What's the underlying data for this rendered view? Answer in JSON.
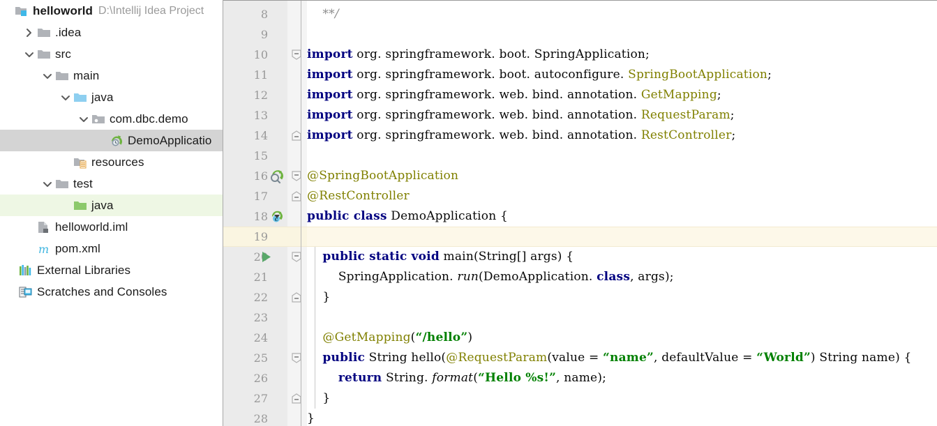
{
  "window": {
    "app": "IntelliJ IDEA",
    "theme_accent": "#3592c4"
  },
  "sidebar": {
    "panel_name": "Project",
    "background": "#ffffff",
    "selected_row_color": "#d4d4d4",
    "test_source_row_color": "#eef7e4",
    "project": {
      "name": "helloworld",
      "path": "D:\\Intellij Idea Project",
      "icon": "project-module-folder-icon"
    },
    "items": [
      {
        "label": ".idea",
        "icon": "folder-icon",
        "indent": 1,
        "twisty": "collapsed",
        "selected": false
      },
      {
        "label": "src",
        "icon": "folder-icon",
        "indent": 1,
        "twisty": "expanded",
        "selected": false
      },
      {
        "label": "main",
        "icon": "folder-icon",
        "indent": 2,
        "twisty": "expanded",
        "selected": false
      },
      {
        "label": "java",
        "icon": "source-root-folder-icon",
        "indent": 3,
        "twisty": "expanded",
        "selected": false
      },
      {
        "label": "com.dbc.demo",
        "icon": "package-folder-icon",
        "indent": 4,
        "twisty": "expanded",
        "selected": false
      },
      {
        "label": "DemoApplicatio",
        "icon": "spring-boot-class-icon",
        "indent": 5,
        "twisty": "none",
        "selected": "gray"
      },
      {
        "label": "resources",
        "icon": "resources-folder-icon",
        "indent": 3,
        "twisty": "none",
        "selected": false
      },
      {
        "label": "test",
        "icon": "folder-icon",
        "indent": 2,
        "twisty": "expanded",
        "selected": false
      },
      {
        "label": "java",
        "icon": "test-source-folder-icon",
        "indent": 3,
        "twisty": "none",
        "selected": "green"
      },
      {
        "label": "helloworld.iml",
        "icon": "iml-module-file-icon",
        "indent": 1,
        "twisty": "none",
        "selected": false
      },
      {
        "label": "pom.xml",
        "icon": "maven-file-icon",
        "indent": 1,
        "twisty": "none",
        "selected": false
      },
      {
        "label": "External Libraries",
        "icon": "external-libraries-icon",
        "indent": 0,
        "twisty": "none",
        "selected": false
      },
      {
        "label": "Scratches and Consoles",
        "icon": "scratches-icon",
        "indent": 0,
        "twisty": "none",
        "selected": false
      }
    ]
  },
  "editor": {
    "file": "DemoApplication",
    "caret_line_number": 19,
    "caret_line_color": "#fdf8e9",
    "gutter_color": "#ebebeb",
    "first_visible_line": 8,
    "last_visible_line": 28,
    "colors": {
      "keyword": "#000080",
      "annotation": "#808000",
      "string": "#008000",
      "comment": "#8c8c8c",
      "text": "#080808",
      "line_number": "#999999"
    },
    "lines": [
      {
        "num": 8,
        "fold": "none",
        "gutter_icon": "none",
        "tokens": [
          {
            "t": "    ",
            "c": "plain"
          },
          {
            "t": "**/",
            "c": "cmt"
          }
        ]
      },
      {
        "num": 9,
        "fold": "none",
        "gutter_icon": "none",
        "tokens": []
      },
      {
        "num": 10,
        "fold": "minus-top",
        "gutter_icon": "none",
        "tokens": [
          {
            "t": "import",
            "c": "kw"
          },
          {
            "t": " org. springframework. boot. SpringApplication;",
            "c": "plain"
          }
        ]
      },
      {
        "num": 11,
        "fold": "none",
        "gutter_icon": "none",
        "tokens": [
          {
            "t": "import",
            "c": "kw"
          },
          {
            "t": " org. springframework. boot. autoconfigure. ",
            "c": "plain"
          },
          {
            "t": "SpringBootApplication",
            "c": "anno"
          },
          {
            "t": ";",
            "c": "plain"
          }
        ]
      },
      {
        "num": 12,
        "fold": "none",
        "gutter_icon": "none",
        "tokens": [
          {
            "t": "import",
            "c": "kw"
          },
          {
            "t": " org. springframework. web. bind. annotation. ",
            "c": "plain"
          },
          {
            "t": "GetMapping",
            "c": "anno"
          },
          {
            "t": ";",
            "c": "plain"
          }
        ]
      },
      {
        "num": 13,
        "fold": "none",
        "gutter_icon": "none",
        "tokens": [
          {
            "t": "import",
            "c": "kw"
          },
          {
            "t": " org. springframework. web. bind. annotation. ",
            "c": "plain"
          },
          {
            "t": "RequestParam",
            "c": "anno"
          },
          {
            "t": ";",
            "c": "plain"
          }
        ]
      },
      {
        "num": 14,
        "fold": "minus-bottom",
        "gutter_icon": "none",
        "tokens": [
          {
            "t": "import",
            "c": "kw"
          },
          {
            "t": " org. springframework. web. bind. annotation. ",
            "c": "plain"
          },
          {
            "t": "RestController",
            "c": "anno"
          },
          {
            "t": ";",
            "c": "plain"
          }
        ]
      },
      {
        "num": 15,
        "fold": "none",
        "gutter_icon": "none",
        "tokens": []
      },
      {
        "num": 16,
        "fold": "minus-top",
        "gutter_icon": "spring-bean-icon",
        "tokens": [
          {
            "t": "@SpringBootApplication",
            "c": "anno"
          }
        ]
      },
      {
        "num": 17,
        "fold": "minus-bottom",
        "gutter_icon": "none",
        "tokens": [
          {
            "t": "@RestController",
            "c": "anno"
          }
        ]
      },
      {
        "num": 18,
        "fold": "none",
        "gutter_icon": "spring-class-run-icon",
        "tokens": [
          {
            "t": "public class",
            "c": "kw"
          },
          {
            "t": " DemoApplication {",
            "c": "plain"
          }
        ]
      },
      {
        "num": 19,
        "fold": "none",
        "gutter_icon": "none",
        "tokens": []
      },
      {
        "num": 20,
        "fold": "minus-top",
        "gutter_icon": "run-method-icon",
        "indent_guide": true,
        "tokens": [
          {
            "t": "    ",
            "c": "plain"
          },
          {
            "t": "public static void",
            "c": "kw"
          },
          {
            "t": " main(String[] args) {",
            "c": "plain"
          }
        ]
      },
      {
        "num": 21,
        "fold": "none",
        "gutter_icon": "none",
        "indent_guide": true,
        "tokens": [
          {
            "t": "        SpringApplication. ",
            "c": "plain"
          },
          {
            "t": "run",
            "c": "stat"
          },
          {
            "t": "(DemoApplication. ",
            "c": "plain"
          },
          {
            "t": "class",
            "c": "kw"
          },
          {
            "t": ", args);",
            "c": "plain"
          }
        ]
      },
      {
        "num": 22,
        "fold": "minus-bottom",
        "gutter_icon": "none",
        "indent_guide": true,
        "tokens": [
          {
            "t": "    }",
            "c": "plain"
          }
        ]
      },
      {
        "num": 23,
        "fold": "none",
        "gutter_icon": "none",
        "indent_guide": true,
        "tokens": []
      },
      {
        "num": 24,
        "fold": "none",
        "gutter_icon": "none",
        "indent_guide": true,
        "tokens": [
          {
            "t": "    ",
            "c": "plain"
          },
          {
            "t": "@GetMapping",
            "c": "anno"
          },
          {
            "t": "(",
            "c": "plain"
          },
          {
            "t": "“/hello”",
            "c": "str"
          },
          {
            "t": ")",
            "c": "plain"
          }
        ]
      },
      {
        "num": 25,
        "fold": "minus-top",
        "gutter_icon": "none",
        "indent_guide": true,
        "tokens": [
          {
            "t": "    ",
            "c": "plain"
          },
          {
            "t": "public",
            "c": "kw"
          },
          {
            "t": " String hello(",
            "c": "plain"
          },
          {
            "t": "@RequestParam",
            "c": "anno"
          },
          {
            "t": "(value = ",
            "c": "plain"
          },
          {
            "t": "“name”",
            "c": "str"
          },
          {
            "t": ", defaultValue = ",
            "c": "plain"
          },
          {
            "t": "“World”",
            "c": "str"
          },
          {
            "t": ") String name) {",
            "c": "plain"
          }
        ]
      },
      {
        "num": 26,
        "fold": "none",
        "gutter_icon": "none",
        "indent_guide": true,
        "tokens": [
          {
            "t": "        ",
            "c": "plain"
          },
          {
            "t": "return",
            "c": "kw"
          },
          {
            "t": " String. ",
            "c": "plain"
          },
          {
            "t": "format",
            "c": "stat"
          },
          {
            "t": "(",
            "c": "plain"
          },
          {
            "t": "“Hello %s!”",
            "c": "str"
          },
          {
            "t": ", name);",
            "c": "plain"
          }
        ]
      },
      {
        "num": 27,
        "fold": "minus-bottom",
        "gutter_icon": "none",
        "indent_guide": true,
        "tokens": [
          {
            "t": "    }",
            "c": "plain"
          }
        ]
      },
      {
        "num": 28,
        "fold": "none",
        "gutter_icon": "none",
        "tokens": [
          {
            "t": "}",
            "c": "plain"
          }
        ]
      }
    ]
  }
}
